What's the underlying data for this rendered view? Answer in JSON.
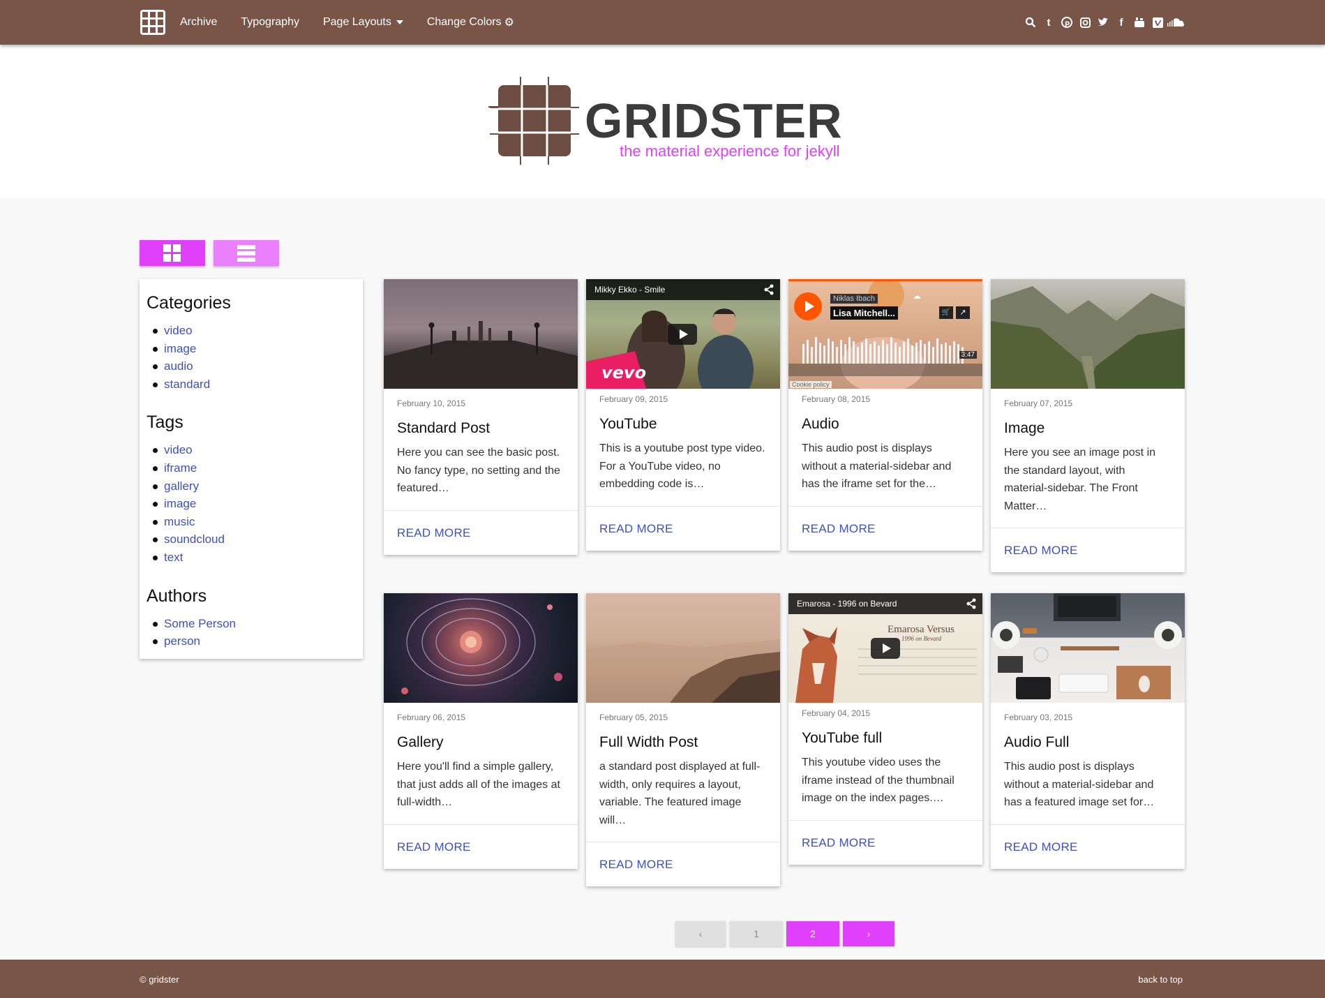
{
  "nav": {
    "links": [
      "Archive",
      "Typography",
      "Page Layouts",
      "Change Colors"
    ],
    "social_icons": [
      "search-icon",
      "tumblr-icon",
      "pinterest-icon",
      "instagram-icon",
      "twitter-icon",
      "facebook-icon",
      "youtube-icon",
      "vimeo-icon",
      "soundcloud-icon"
    ]
  },
  "header": {
    "brand": "GRIDSTER",
    "tagline": "the material experience for jekyll"
  },
  "sidebar": {
    "categories_title": "Categories",
    "categories": [
      "video",
      "image",
      "audio",
      "standard"
    ],
    "tags_title": "Tags",
    "tags": [
      "video",
      "iframe",
      "gallery",
      "image",
      "music",
      "soundcloud",
      "text"
    ],
    "authors_title": "Authors",
    "authors": [
      "Some Person",
      "person"
    ]
  },
  "posts": [
    {
      "date": "February 10, 2015",
      "title": "Standard Post",
      "excerpt": "Here you can see the basic post. No fancy type, no setting and the featured…",
      "action": "READ MORE"
    },
    {
      "date": "February 09, 2015",
      "title": "YouTube",
      "excerpt": "This is a youtube post type video. For a YouTube video, no embedding code is…",
      "action": "READ MORE",
      "video_title": "Mikky Ekko - Smile",
      "video_brand": "vevo"
    },
    {
      "date": "February 08, 2015",
      "title": "Audio",
      "excerpt": "This audio post is displays without a material-sidebar and has the iframe set for the…",
      "action": "READ MORE",
      "artist": "Niklas Ibach",
      "track": "Lisa Mitchell...",
      "duration": "3:47",
      "cookie": "Cookie policy"
    },
    {
      "date": "February 07, 2015",
      "title": "Image",
      "excerpt": "Here you see an image post in the standard layout, with material-sidebar. The Front Matter…",
      "action": "READ MORE"
    },
    {
      "date": "February 06, 2015",
      "title": "Gallery",
      "excerpt": "Here you'll find a simple gallery, that just adds all of the images at full-width…",
      "action": "READ MORE"
    },
    {
      "date": "February 05, 2015",
      "title": "Full Width Post",
      "excerpt": "a standard post displayed at full-width, only requires a layout, variable. The featured image will…",
      "action": "READ MORE"
    },
    {
      "date": "February 04, 2015",
      "title": "YouTube full",
      "excerpt": "This youtube video uses the iframe instead of the thumbnail image on the index pages.…",
      "action": "READ MORE",
      "video_title": "Emarosa - 1996 on Bevard",
      "video_overlay": "Emarosa Versus",
      "video_sub": "1996 on Bevard"
    },
    {
      "date": "February 03, 2015",
      "title": "Audio Full",
      "excerpt": "This audio post is displays without a material-sidebar and has a featured image set for…",
      "action": "READ MORE"
    }
  ],
  "pagination": {
    "prev": "‹",
    "pages": [
      "1",
      "2"
    ],
    "current": "2",
    "next": "›"
  },
  "footer": {
    "copyright": "© gridster",
    "back_to_top": "back to top"
  },
  "colors": {
    "primary": "#795548",
    "accent": "#e040fb",
    "accent_light": "#ea80fc",
    "link": "#3f51b5"
  }
}
